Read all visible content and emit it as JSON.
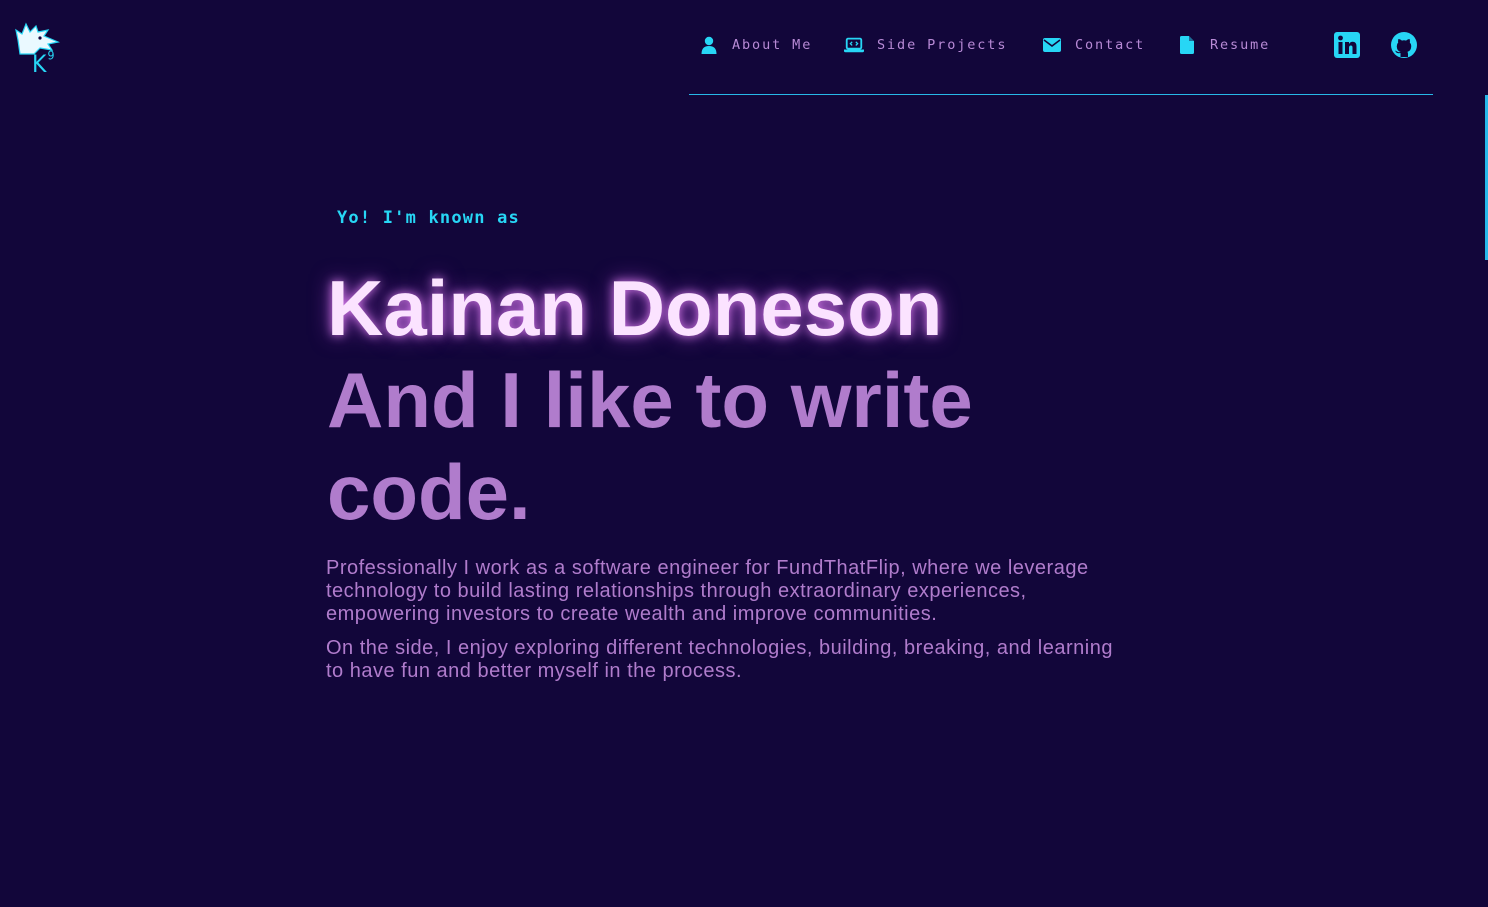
{
  "logo": {
    "letter": "K",
    "superscript": "9",
    "icon": "wolf-head-icon"
  },
  "nav": {
    "items": [
      {
        "label": "About Me",
        "icon": "user-icon"
      },
      {
        "label": "Side Projects",
        "icon": "laptop-code-icon"
      },
      {
        "label": "Contact",
        "icon": "envelope-icon"
      },
      {
        "label": "Resume",
        "icon": "file-icon"
      }
    ],
    "social": [
      {
        "name": "LinkedIn",
        "icon": "linkedin-icon"
      },
      {
        "name": "GitHub",
        "icon": "github-icon"
      }
    ]
  },
  "hero": {
    "intro": "Yo! I'm known as",
    "name": "Kainan Doneson",
    "tagline": "And I like to write code.",
    "bio": [
      "Professionally I work as a software engineer for FundThatFlip, where we leverage technology to build lasting relationships through extraordinary experiences, empowering investors to create wealth and improve communities.",
      "On the side, I enjoy exploring different technologies, building, breaking, and learning to have fun and better myself in the process."
    ]
  },
  "colors": {
    "background": "#12063a",
    "accent": "#27d6f5",
    "text_purple": "#b07ccc",
    "name_pink": "#fbe3ff"
  }
}
